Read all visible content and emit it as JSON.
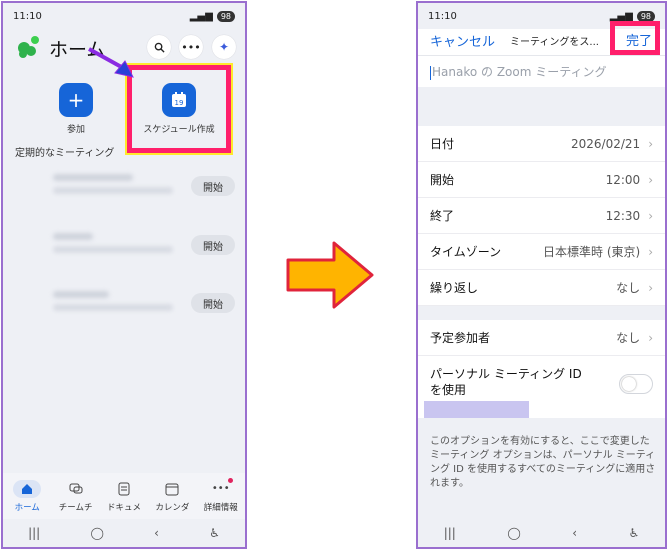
{
  "status_bar": {
    "time": "11:10",
    "battery": "98"
  },
  "left": {
    "title": "ホーム",
    "actions": [
      {
        "label": "参加",
        "icon": "plus-icon"
      },
      {
        "label": "スケジュール作成",
        "icon": "calendar-icon",
        "day": "19"
      }
    ],
    "section_label": "定期的なミーティング",
    "meetings": [
      {
        "start_label": "開始"
      },
      {
        "start_label": "開始"
      },
      {
        "start_label": "開始"
      }
    ],
    "tabs": [
      {
        "label": "ホーム",
        "icon": "home-icon",
        "active": true
      },
      {
        "label": "チームチ",
        "icon": "chat-icon"
      },
      {
        "label": "ドキュメ",
        "icon": "document-icon"
      },
      {
        "label": "カレンダ",
        "icon": "calendar-icon"
      },
      {
        "label": "詳細情報",
        "icon": "more-icon"
      }
    ]
  },
  "right": {
    "cancel_label": "キャンセル",
    "title": "ミーティングをス...",
    "done_label": "完了",
    "topic_placeholder": "Hanako の Zoom ミーティング",
    "settings": [
      {
        "label": "日付",
        "value": "2026/02/21"
      },
      {
        "label": "開始",
        "value": "12:00"
      },
      {
        "label": "終了",
        "value": "12:30"
      },
      {
        "label": "タイムゾーン",
        "value": "日本標準時 (東京)"
      },
      {
        "label": "繰り返し",
        "value": "なし"
      }
    ],
    "attendees": {
      "label": "予定参加者",
      "value": "なし"
    },
    "pmi_line1": "パーソナル ミーティング ID",
    "pmi_line2": "を使用",
    "pmi_enabled": false,
    "note": "このオプションを有効にすると、ここで変更したミーティング オプションは、パーソナル ミーティング ID を使用するすべてのミーティングに適用されます。"
  },
  "colors": {
    "highlight": "#ff1f6b",
    "accent": "#1665d8",
    "arrow": "#ffb400"
  }
}
